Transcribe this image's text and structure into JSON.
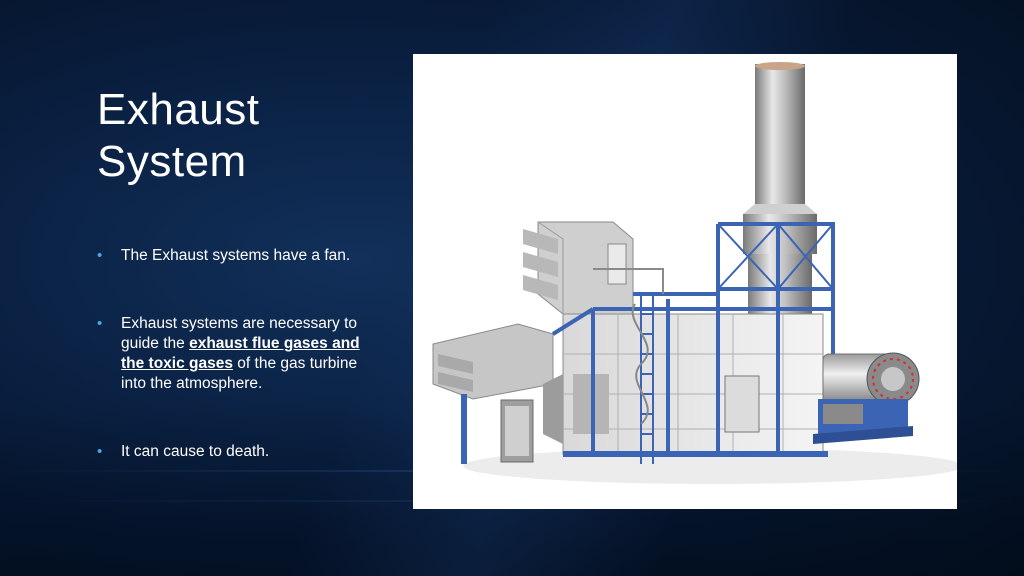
{
  "slide": {
    "title_line1": "Exhaust",
    "title_line2": "System",
    "bullets": [
      {
        "text": "The Exhaust systems have a fan."
      },
      {
        "pre": "Exhaust systems are necessary to guide the ",
        "em": "exhaust flue gases and the toxic gases",
        "post": " of the gas turbine into the atmosphere."
      },
      {
        "text": "It can cause to death."
      }
    ],
    "bullet_glyph": "•"
  },
  "colors": {
    "background": "#0b2346",
    "bullet": "#4aa6e6",
    "frame_blue": "#3c64b4"
  }
}
